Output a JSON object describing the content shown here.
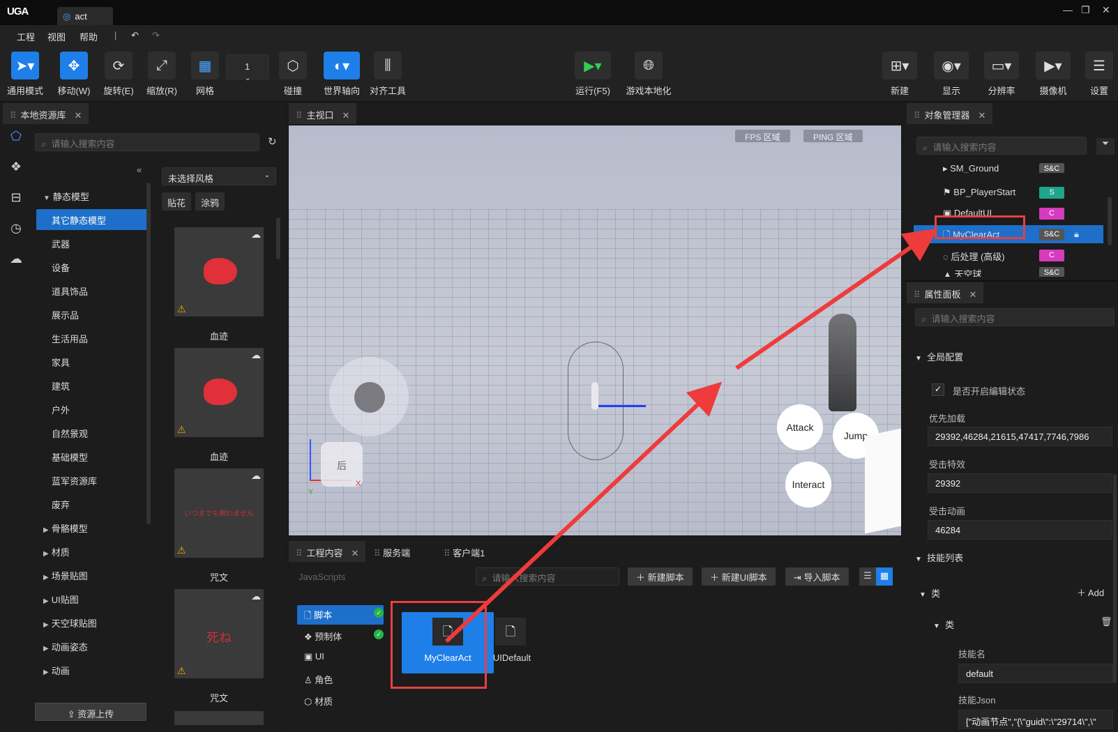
{
  "app": {
    "logo": "UGA",
    "tab_title": "act"
  },
  "menu": [
    "工程",
    "视图",
    "帮助"
  ],
  "toolbar": {
    "tools": [
      {
        "label": "通用模式",
        "icon": "cursor-icon"
      },
      {
        "label": "移动(W)",
        "icon": "move-icon"
      },
      {
        "label": "旋转(E)",
        "icon": "rotate-icon"
      },
      {
        "label": "缩放(R)",
        "icon": "scale-icon"
      },
      {
        "label": "网格",
        "icon": "grid-icon"
      }
    ],
    "grid_value": "1",
    "collision": "碰撞",
    "world_axis": "世界轴向",
    "align": "对齐工具",
    "run": "运行(F5)",
    "localize": "游戏本地化",
    "right_tools": [
      "新建",
      "显示",
      "分辨率",
      "摄像机",
      "设置"
    ]
  },
  "left_panel": {
    "tab": "本地资源库",
    "search_placeholder": "请输入搜索内容",
    "tree": [
      {
        "label": "静态模型",
        "caret": "▼",
        "level": 0
      },
      {
        "label": "其它静态模型",
        "level": 1,
        "selected": true
      },
      {
        "label": "武器",
        "level": 1
      },
      {
        "label": "设备",
        "level": 1
      },
      {
        "label": "道具饰品",
        "level": 1
      },
      {
        "label": "展示品",
        "level": 1
      },
      {
        "label": "生活用品",
        "level": 1
      },
      {
        "label": "家具",
        "level": 1
      },
      {
        "label": "建筑",
        "level": 1
      },
      {
        "label": "户外",
        "level": 1
      },
      {
        "label": "自然景观",
        "level": 1
      },
      {
        "label": "基础模型",
        "level": 1
      },
      {
        "label": "蓝军资源库",
        "level": 1
      },
      {
        "label": "废弃",
        "level": 1
      },
      {
        "label": "骨骼模型",
        "caret": "▶",
        "level": 0
      },
      {
        "label": "材质",
        "caret": "▶",
        "level": 0
      },
      {
        "label": "场景贴图",
        "caret": "▶",
        "level": 0
      },
      {
        "label": "UI贴图",
        "caret": "▶",
        "level": 0
      },
      {
        "label": "天空球贴图",
        "caret": "▶",
        "level": 0
      },
      {
        "label": "动画姿态",
        "caret": "▶",
        "level": 0
      },
      {
        "label": "动画",
        "caret": "▶",
        "level": 0
      }
    ],
    "style_select": "未选择风格",
    "filters": [
      "贴花",
      "涂鸦"
    ],
    "thumbs": [
      {
        "label": "血迹",
        "color": "#e0303a"
      },
      {
        "label": "血迹",
        "color": "#e0303a"
      },
      {
        "label": "咒文",
        "text": "いつまでも側わません"
      },
      {
        "label": "咒文",
        "text": "死ね"
      }
    ],
    "upload_button": "资源上传"
  },
  "viewport": {
    "tab": "主视口",
    "fps_tag": "FPS 区域",
    "ping_tag": "PING 区域",
    "buttons": [
      "Attack",
      "Jump",
      "Interact"
    ],
    "cube_label": "后",
    "axis_x": "X",
    "axis_y": "Y"
  },
  "bottom": {
    "tabs": [
      "工程内容",
      "服务端",
      "客户端1"
    ],
    "section": "JavaScripts",
    "search_placeholder": "请输入搜索内容",
    "buttons": [
      "新建脚本",
      "新建UI脚本",
      "导入脚本"
    ],
    "categories": [
      "脚本",
      "预制体",
      "UI",
      "角色",
      "材质"
    ],
    "files": [
      "MyClearAct",
      "UIDefault"
    ]
  },
  "objects": {
    "tab": "对象管理器",
    "search_placeholder": "请输入搜索内容",
    "rows": [
      {
        "label": "SM_Ground",
        "badge": "S&C",
        "badge_color": "#555555"
      },
      {
        "label": "BP_PlayerStart",
        "badge": "S",
        "badge_color": "#1fa58a"
      },
      {
        "label": "DefaultUI",
        "badge": "C",
        "badge_color": "#d63bbd"
      },
      {
        "label": "MyClearAct",
        "badge": "S&C",
        "badge_color": "#555555",
        "selected": true
      },
      {
        "label": "后处理 (高级)",
        "badge": "C",
        "badge_color": "#d63bbd"
      },
      {
        "label": "天空球",
        "badge": "S&C",
        "badge_color": "#555555"
      }
    ]
  },
  "properties": {
    "tab": "属性面板",
    "search_placeholder": "请输入搜索内容",
    "section": "全局配置",
    "edit_checkbox": "是否开启编辑状态",
    "fields": [
      {
        "label": "优先加载",
        "value": "29392,46284,21615,47417,7746,7986"
      },
      {
        "label": "受击特效",
        "value": "29392"
      },
      {
        "label": "受击动画",
        "value": "46284"
      }
    ],
    "skill_section": "技能列表",
    "class_label": "类",
    "add_label": "Add",
    "sub_class": "类",
    "skill_name_label": "技能名",
    "skill_name_value": "default",
    "skill_json_label": "技能Json",
    "skill_json_value": "[\"动画节点\",\"{\\\"guid\\\":\\\"29714\\\",\\\""
  }
}
